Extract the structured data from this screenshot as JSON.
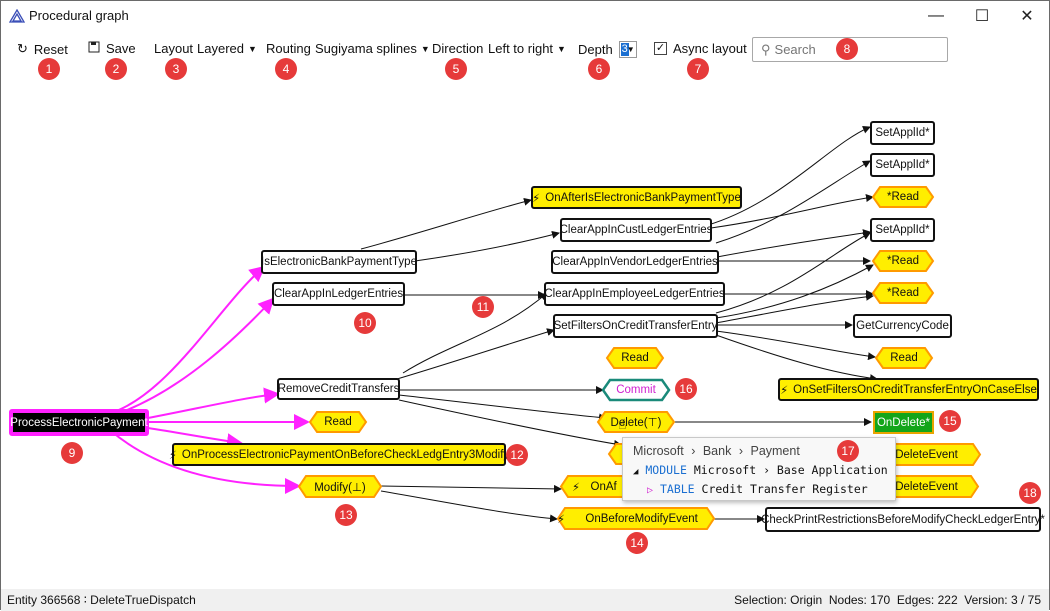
{
  "window": {
    "title": "Procedural graph"
  },
  "toolbar": {
    "reset": "Reset",
    "save": "Save",
    "layout_label": "Layout",
    "layout_value": "Layered",
    "routing_label": "Routing",
    "routing_value": "Sugiyama splines",
    "direction_label": "Direction",
    "direction_value": "Left to right",
    "depth_label": "Depth",
    "depth_value": "3",
    "async_label": "Async layout",
    "async_checked": true,
    "search_placeholder": "Search"
  },
  "badges": [
    "1",
    "2",
    "3",
    "4",
    "5",
    "6",
    "7",
    "8",
    "9",
    "10",
    "11",
    "12",
    "13",
    "14",
    "15",
    "16",
    "17",
    "18"
  ],
  "nodes": {
    "root": "ProcessElectronicPayment",
    "is_ebp": "IsElectronicBankPaymentType",
    "clear_ledger": "ClearAppInLedgerEntries",
    "remove_ct": "RemoveCreditTransfers",
    "read1": "Read",
    "on_process": "OnProcessElectronicPaymentOnBeforeCheckLedgEntry3Modify",
    "modify": "Modify(⊥)",
    "on_after_is": "OnAfterIsElectronicBankPaymentType",
    "clear_cust": "ClearAppInCustLedgerEntries",
    "clear_vendor": "ClearAppInVendorLedgerEntries",
    "clear_employee": "ClearAppInEmployeeLedgerEntries",
    "set_filters": "SetFiltersOnCreditTransferEntry",
    "read2": "Read",
    "commit": "Commit",
    "delete": "Delete(⊤)",
    "on_after_delete_partial": "OnAf",
    "on_after_delete_tail": "reDeleteEvent",
    "on_before_delete_tail": "erDeleteEvent",
    "on_before_modify": "OnBeforeModifyEvent",
    "set_appl_1": "SetApplId*",
    "set_appl_2": "SetApplId*",
    "read_star_1": "*Read",
    "set_appl_3": "SetApplId*",
    "read_star_2": "*Read",
    "read_star_3": "*Read",
    "get_currency": "GetCurrencyCode",
    "read3": "Read",
    "on_set_filters": "OnSetFiltersOnCreditTransferEntryOnCaseElse",
    "on_delete": "OnDelete*",
    "check_print": "CheckPrintRestrictionsBeforeModifyCheckLedgerEntry*"
  },
  "tooltip": {
    "crumb1": "Microsoft",
    "crumb2": "Bank",
    "crumb3": "Payment",
    "module_kw": "MODULE",
    "module_value": "Microsoft › Base Application",
    "table_kw": "TABLE",
    "table_value": "Credit Transfer Register"
  },
  "status": {
    "entity": "Entity 366568 ∶ DeleteTrueDispatch",
    "summary": "Selection: Origin  Nodes: 170  Edges: 222  Version: 3 / 75"
  },
  "colors": {
    "edge_magenta": "#ff22ff",
    "event_yellow": "#ffee00",
    "hex_orange": "#ff9a00",
    "commit_teal": "#1a8a7a",
    "badge_red": "#e63a3a",
    "ondelete_green": "#13a51a"
  }
}
